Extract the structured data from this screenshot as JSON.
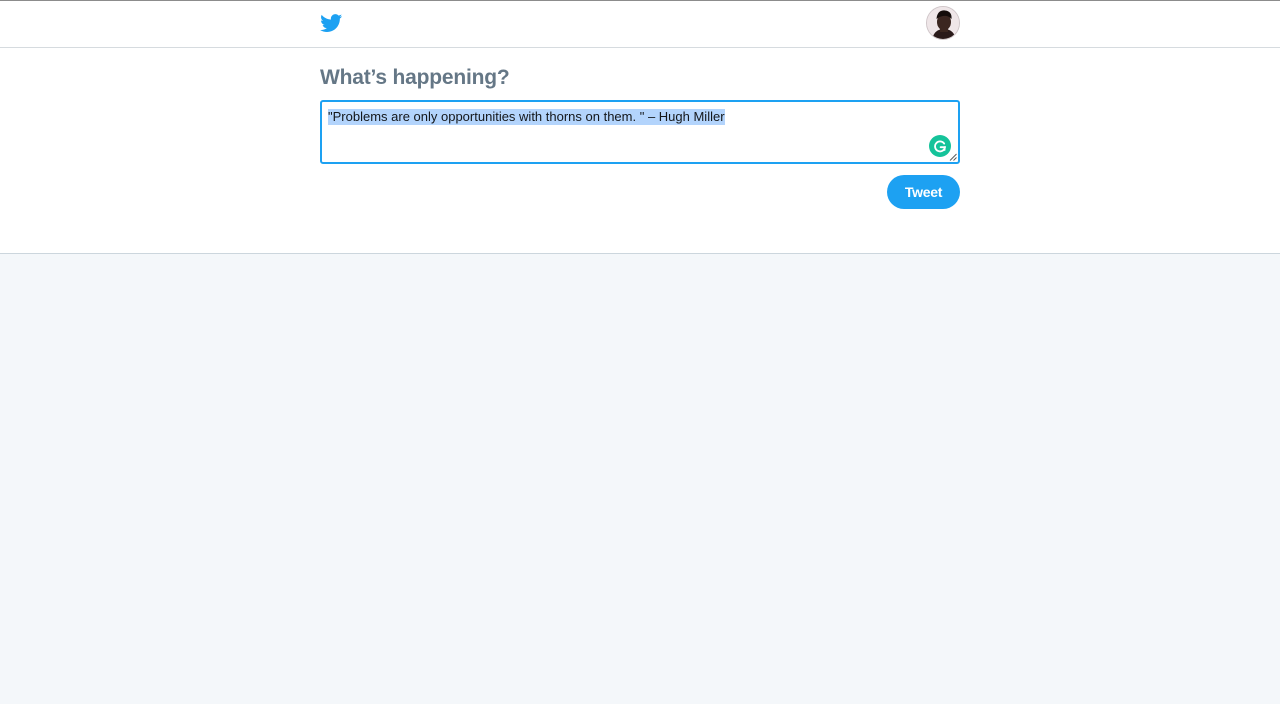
{
  "header": {
    "logo_icon": "twitter-bird-icon",
    "avatar_icon": "user-avatar",
    "brand_color": "#1da1f2"
  },
  "composer": {
    "heading": "What’s happening?",
    "text_value": "\"Problems are only opportunities with thorns on them. \" – Hugh Miller",
    "text_selected": true,
    "grammarly_icon": "grammarly-g-icon",
    "tweet_label": "Tweet"
  }
}
